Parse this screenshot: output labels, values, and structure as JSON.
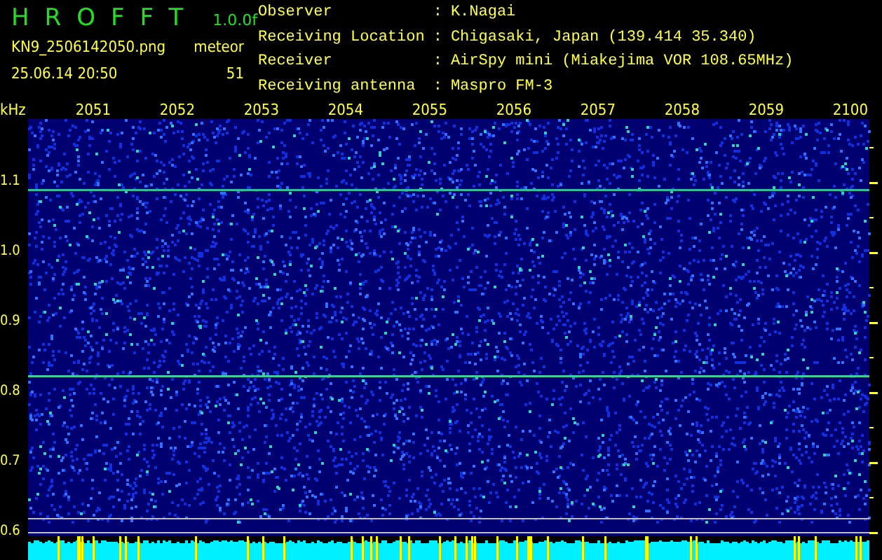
{
  "header": {
    "app_name": "HROFFT",
    "version": "1.0.0f",
    "file_name": "KN9_2506142050.png",
    "datetime": "25.06.14 20:50",
    "count_label": "meteor",
    "count": "51"
  },
  "station_info": [
    {
      "label": "Observer",
      "separator": ":",
      "value": "K.Nagai"
    },
    {
      "label": "Receiving Location",
      "separator": ":",
      "value": "Chigasaki, Japan (139.414 35.340)"
    },
    {
      "label": "Receiver",
      "separator": ":",
      "value": "AirSpy mini (Miakejima VOR 108.65MHz)"
    },
    {
      "label": "Receiving antenna",
      "separator": ":",
      "value": "Maspro FM-3"
    }
  ],
  "spectrogram": {
    "unit": "kHz",
    "time_labels": [
      "2051",
      "2052",
      "2053",
      "2054",
      "2055",
      "2056",
      "2057",
      "2058",
      "2059",
      "2100"
    ],
    "frequency_labels": [
      "1.1",
      "1.0",
      "0.9",
      "0.8",
      "0.7",
      "0.6"
    ]
  }
}
